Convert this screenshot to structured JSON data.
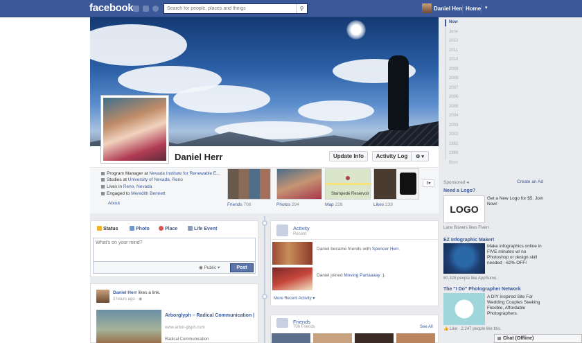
{
  "topbar": {
    "logo": "facebook",
    "search_placeholder": "Search for people, places and things",
    "user_name": "Daniel Herr",
    "home_label": "Home",
    "dropdown_glyph": "▾"
  },
  "profile": {
    "name": "Daniel Herr",
    "update_info_label": "Update Info",
    "activity_log_label": "Activity Log",
    "gear_label": "⚙ ▾",
    "info": {
      "work_prefix": "Program Manager at ",
      "work_link": "Nevada Institute for Renewable E...",
      "studies_prefix": "Studies at ",
      "studies_link": "University of Nevada, Reno",
      "lives_prefix": "Lives in ",
      "lives_link": "Reno, Nevada",
      "engaged_prefix": "Engaged to ",
      "engaged_link": "Meredith Bennett"
    },
    "about_label": "About"
  },
  "tiles": {
    "friends_label": "Friends",
    "friends_count": "706",
    "photos_label": "Photos",
    "photos_count": "294",
    "map_label": "Map",
    "map_count": "228",
    "map_place": "Stampede Reservoir",
    "likes_label": "Likes",
    "likes_count": "239",
    "more_label": "3▾"
  },
  "composer": {
    "tab_status": "Status",
    "tab_photo": "Photo",
    "tab_place": "Place",
    "tab_life_event": "Life Event",
    "placeholder": "What's on your mind?",
    "privacy_label": "Public ▾",
    "post_label": "Post"
  },
  "story": {
    "author": "Daniel Herr",
    "action": " likes a link.",
    "time": "3 hours ago · ",
    "link_title": "Arborglyph – Radical Communication |",
    "link_url": "www.arbor-glyph.com",
    "link_desc": "Radical Communication"
  },
  "activity": {
    "title": "Activity",
    "subtitle": "Recent",
    "item1_prefix": "Daniel became friends with ",
    "item1_link": "Spencer Herr.",
    "item2_prefix": "Daniel joined ",
    "item2_link": "Moving Partaaaay :).",
    "more_label": "More Recent Activity ▾"
  },
  "friends_box": {
    "title": "Friends",
    "subtitle": "706 Friends",
    "see_all": "See All"
  },
  "timeline_years": [
    "Now",
    "June",
    "2012",
    "2011",
    "2010",
    "2009",
    "2008",
    "2007",
    "2006",
    "2005",
    "2004",
    "2003",
    "2002",
    "1992",
    "1988",
    "Born"
  ],
  "ads": {
    "sponsored_label": "Sponsored",
    "create_ad_label": "Create an Ad",
    "ad1": {
      "title": "Need a Logo?",
      "logo_text": "LOGO",
      "text": "Get a New Logo for $5. Join Now!",
      "social": "Lane Bowers likes Fiverr."
    },
    "ad2": {
      "title": "EZ Infographic Maker!",
      "text": "Make infographics online in FIVE minutes w/ no Photoshop or design skill needed - 62% OFF!",
      "social": "80,328 people like AppSumo."
    },
    "ad3": {
      "title": "The \"I Do\" Photographer Network",
      "text": "A DIY Inspired Site For Wedding Couples Seeking Flexible, Affordable Photographers.",
      "social": "👍 Like · 2,247 people like this."
    }
  },
  "chat": {
    "label": "Chat (Offline)"
  }
}
